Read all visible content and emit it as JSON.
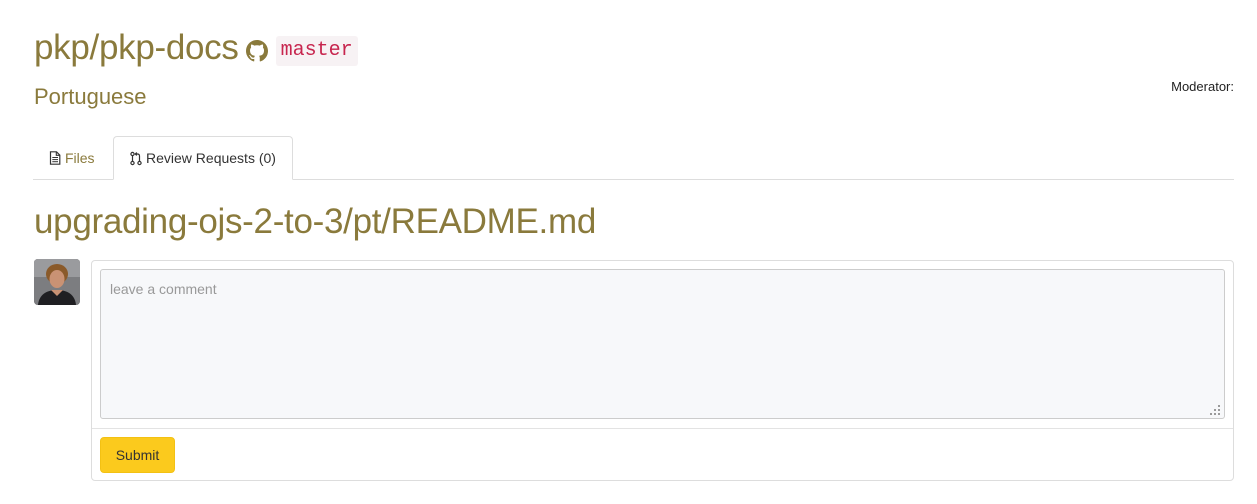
{
  "header": {
    "repo_name": "pkp/pkp-docs",
    "repo_icon": "github-icon",
    "branch": "master",
    "language": "Portuguese",
    "moderator_label": "Moderator:"
  },
  "tabs": [
    {
      "label": "Files",
      "icon": "file-icon",
      "active": false
    },
    {
      "label": "Review Requests (0)",
      "icon": "pull-request-icon",
      "active": true
    }
  ],
  "file": {
    "path": "upgrading-ojs-2-to-3/pt/README.md"
  },
  "comment": {
    "placeholder": "leave a comment",
    "value": "",
    "submit_label": "Submit"
  },
  "colors": {
    "title_gold": "#8a7a3c",
    "branch_red": "#c7254e",
    "submit_yellow": "#fbca1d",
    "border_gray": "#dddddd"
  }
}
